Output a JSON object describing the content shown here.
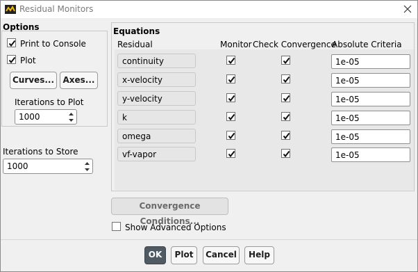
{
  "window": {
    "title": "Residual Monitors",
    "icon": "ansys-fluent-icon"
  },
  "options": {
    "heading": "Options",
    "print_to_console": {
      "label": "Print to Console",
      "checked": true
    },
    "plot": {
      "label": "Plot",
      "checked": true
    },
    "curves_button": "Curves...",
    "axes_button": "Axes...",
    "iterations_to_plot": {
      "label": "Iterations to Plot",
      "value": "1000"
    }
  },
  "iterations_to_store": {
    "label": "Iterations to Store",
    "value": "1000"
  },
  "equations": {
    "heading": "Equations",
    "columns": {
      "residual": "Residual",
      "monitor": "Monitor",
      "check_convergence": "Check Convergence",
      "absolute_criteria": "Absolute Criteria"
    },
    "rows": [
      {
        "residual": "continuity",
        "monitor": true,
        "check": true,
        "criteria": "1e-05"
      },
      {
        "residual": "x-velocity",
        "monitor": true,
        "check": true,
        "criteria": "1e-05"
      },
      {
        "residual": "y-velocity",
        "monitor": true,
        "check": true,
        "criteria": "1e-05"
      },
      {
        "residual": "k",
        "monitor": true,
        "check": true,
        "criteria": "1e-05"
      },
      {
        "residual": "omega",
        "monitor": true,
        "check": true,
        "criteria": "1e-05"
      },
      {
        "residual": "vf-vapor",
        "monitor": true,
        "check": true,
        "criteria": "1e-05"
      }
    ]
  },
  "convergence_conditions_button": "Convergence Conditions...",
  "show_advanced_options": {
    "label": "Show Advanced Options",
    "checked": false
  },
  "footer": {
    "ok": "OK",
    "plot": "Plot",
    "cancel": "Cancel",
    "help": "Help"
  }
}
